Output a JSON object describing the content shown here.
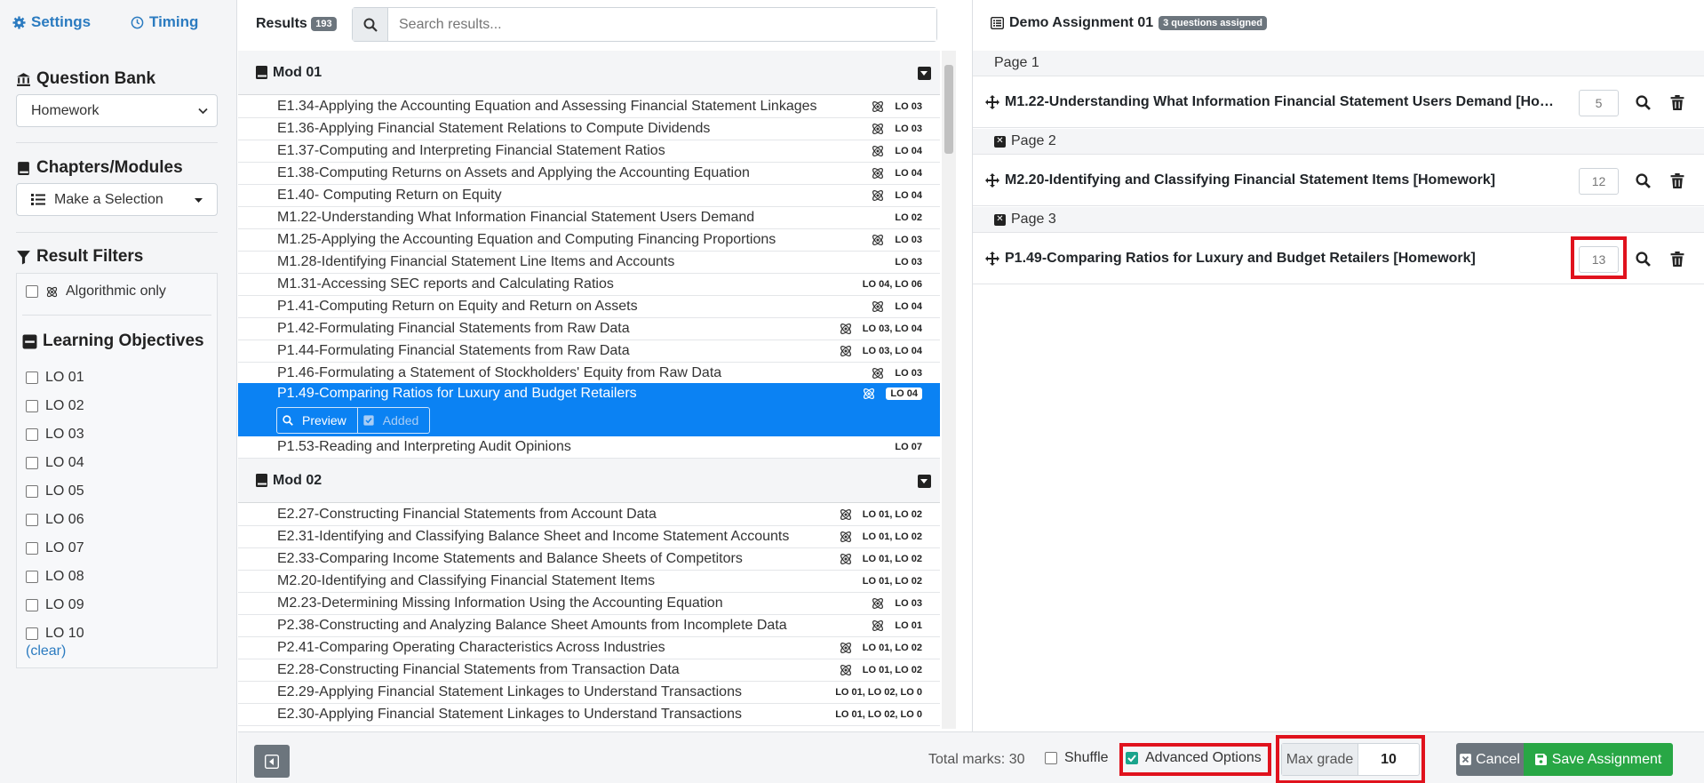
{
  "sidebar": {
    "settings_label": "Settings",
    "timing_label": "Timing",
    "question_bank_heading": "Question Bank",
    "question_bank_value": "Homework",
    "chapters_heading": "Chapters/Modules",
    "chapters_value": "Make a Selection",
    "filters_heading": "Result Filters",
    "algorithmic_label": "Algorithmic only",
    "lo_heading": "Learning Objectives",
    "lo_items": [
      "LO 01",
      "LO 02",
      "LO 03",
      "LO 04",
      "LO 05",
      "LO 06",
      "LO 07",
      "LO 08",
      "LO 09",
      "LO 10"
    ],
    "clear_label": "(clear)"
  },
  "results": {
    "title": "Results",
    "count": "193",
    "search_placeholder": "Search results...",
    "mod1_label": "Mod 01",
    "mod2_label": "Mod 02",
    "mod1_rows": [
      {
        "title": "E1.34-Applying the Accounting Equation and Assessing Financial Statement Linkages",
        "lo": "LO 03",
        "algo": true
      },
      {
        "title": "E1.36-Applying Financial Statement Relations to Compute Dividends",
        "lo": "LO 03",
        "algo": true
      },
      {
        "title": "E1.37-Computing and Interpreting Financial Statement Ratios",
        "lo": "LO 04",
        "algo": true
      },
      {
        "title": "E1.38-Computing Returns on Assets and Applying the Accounting Equation",
        "lo": "LO 04",
        "algo": true
      },
      {
        "title": "E1.40- Computing Return on Equity",
        "lo": "LO 04",
        "algo": true
      },
      {
        "title": "M1.22-Understanding What Information Financial Statement Users Demand",
        "lo": "LO 02",
        "algo": false
      },
      {
        "title": "M1.25-Applying the Accounting Equation and Computing Financing Proportions",
        "lo": "LO 03",
        "algo": true
      },
      {
        "title": "M1.28-Identifying Financial Statement Line Items and Accounts",
        "lo": "LO 03",
        "algo": false
      },
      {
        "title": "M1.31-Accessing SEC reports and Calculating Ratios",
        "lo": "LO 04, LO 06",
        "algo": false
      },
      {
        "title": "P1.41-Computing Return on Equity and Return on Assets",
        "lo": "LO 04",
        "algo": true
      },
      {
        "title": "P1.42-Formulating Financial Statements from Raw Data",
        "lo": "LO 03, LO 04",
        "algo": true
      },
      {
        "title": "P1.44-Formulating Financial Statements from Raw Data",
        "lo": "LO 03, LO 04",
        "algo": true
      },
      {
        "title": "P1.46-Formulating a Statement of Stockholders' Equity from Raw Data",
        "lo": "LO 03",
        "algo": true
      }
    ],
    "selected_row": {
      "title": "P1.49-Comparing Ratios for Luxury and Budget Retailers",
      "lo": "LO 04",
      "preview_label": "Preview",
      "added_label": "Added"
    },
    "after_selected_row": {
      "title": "P1.53-Reading and Interpreting Audit Opinions",
      "lo": "LO 07"
    },
    "mod2_rows": [
      {
        "title": "E2.27-Constructing Financial Statements from Account Data",
        "lo": "LO 01, LO 02",
        "algo": true
      },
      {
        "title": "E2.31-Identifying and Classifying Balance Sheet and Income Statement Accounts",
        "lo": "LO 01, LO 02",
        "algo": true
      },
      {
        "title": "E2.33-Comparing Income Statements and Balance Sheets of Competitors",
        "lo": "LO 01, LO 02",
        "algo": true
      },
      {
        "title": "M2.20-Identifying and Classifying Financial Statement Items",
        "lo": "LO 01, LO 02",
        "algo": false
      },
      {
        "title": "M2.23-Determining Missing Information Using the Accounting Equation",
        "lo": "LO 03",
        "algo": true
      },
      {
        "title": "P2.38-Constructing and Analyzing Balance Sheet Amounts from Incomplete Data",
        "lo": "LO 01",
        "algo": true
      },
      {
        "title": "P2.41-Comparing Operating Characteristics Across Industries",
        "lo": "LO 01, LO 02",
        "algo": true
      },
      {
        "title": "E2.28-Constructing Financial Statements from Transaction Data",
        "lo": "LO 01, LO 02",
        "algo": true
      },
      {
        "title": "E2.29-Applying Financial Statement Linkages to Understand Transactions",
        "lo": "LO 01, LO 02, LO 0",
        "algo": false
      },
      {
        "title": "E2.30-Applying Financial Statement Linkages to Understand Transactions",
        "lo": "LO 01, LO 02, LO 0",
        "algo": false
      }
    ]
  },
  "assignment": {
    "title": "Demo Assignment 01",
    "badge": "3 questions assigned",
    "pages": [
      {
        "label": "Page 1",
        "question": "M1.22-Understanding What Information Financial Statement Users Demand [Homework]",
        "points": "5"
      },
      {
        "label": "Page 2",
        "question": "M2.20-Identifying and Classifying Financial Statement Items [Homework]",
        "points": "12"
      },
      {
        "label": "Page 3",
        "question": "P1.49-Comparing Ratios for Luxury and Budget Retailers [Homework]",
        "points": "13"
      }
    ]
  },
  "bottom": {
    "total_marks": "Total marks: 30",
    "shuffle_label": "Shuffle",
    "advanced_label": "Advanced Options",
    "max_grade_label": "Max grade",
    "max_grade_value": "10",
    "cancel_label": "Cancel",
    "save_label": "Save Assignment"
  },
  "colors": {
    "accent_blue": "#0b82f3",
    "link_blue": "#2b7bc0",
    "save_green": "#28a745",
    "highlight_red": "#e0121d"
  }
}
